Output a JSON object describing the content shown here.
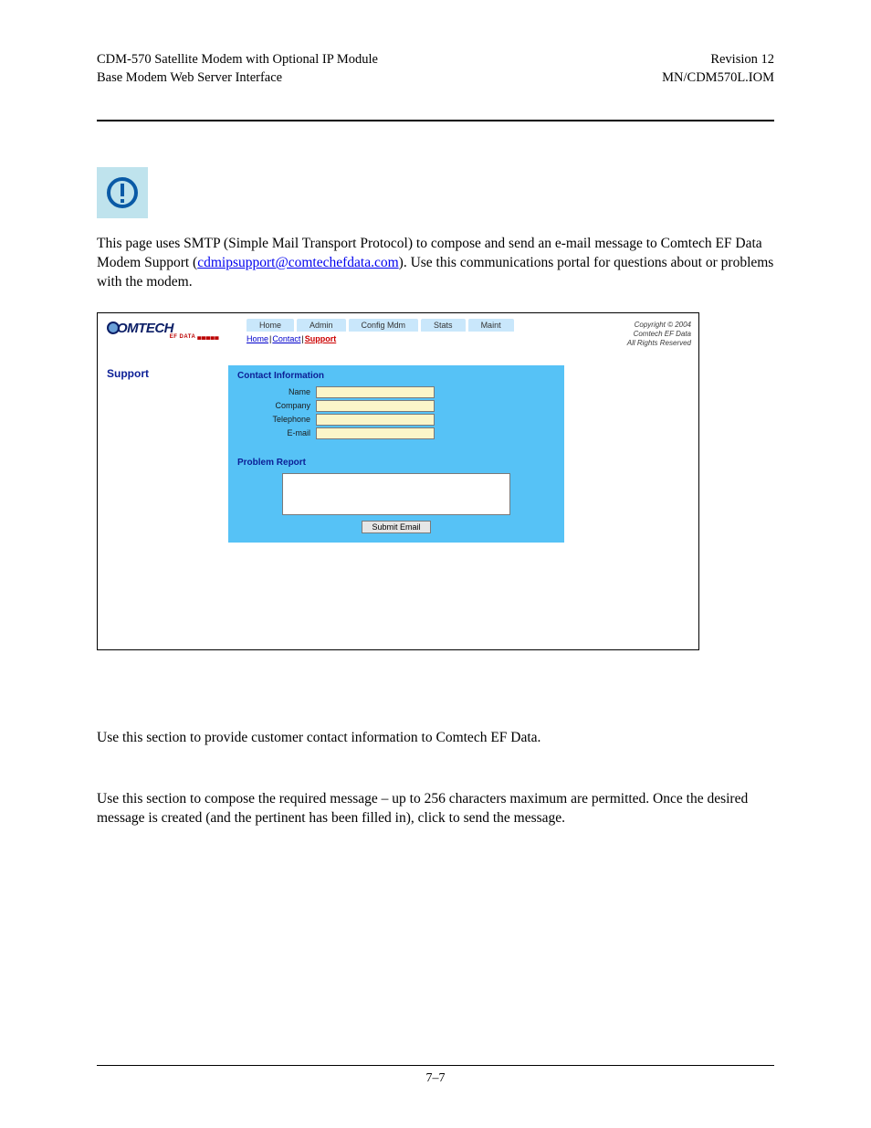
{
  "header": {
    "left_line1": "CDM-570 Satellite Modem with Optional IP Module",
    "left_line2": "Base Modem Web Server Interface",
    "right_line1": "Revision 12",
    "right_line2": "MN/CDM570L.IOM"
  },
  "intro": {
    "before": "This page uses SMTP (Simple Mail Transport Protocol) to compose and send an e-mail message to Comtech EF Data Modem Support (",
    "link": "cdmipsupport@comtechefdata.com",
    "after": "). Use this communications portal for questions about or problems with the modem."
  },
  "figure": {
    "logo_text": "OMTECH",
    "logo_sub": "EF DATA ▄▄▄▄▄",
    "tabs": [
      "Home",
      "Admin",
      "Config Mdm",
      "Stats",
      "Maint"
    ],
    "sublinks": {
      "home": "Home",
      "contact": "Contact",
      "support": "Support"
    },
    "copyright_l1": "Copyright © 2004",
    "copyright_l2": "Comtech EF Data",
    "copyright_l3": "All Rights Reserved",
    "support_title": "Support",
    "contact_panel": {
      "title": "Contact Information",
      "fields": {
        "name": "Name",
        "company": "Company",
        "telephone": "Telephone",
        "email": "E-mail"
      }
    },
    "problem_panel": {
      "title": "Problem Report",
      "submit": "Submit Email"
    }
  },
  "body": {
    "p1": "Use this section to provide customer contact information to Comtech EF Data.",
    "p2_a": "Use this section to compose the required message – up to 256 characters maximum are permitted. Once the desired message is created (and the pertinent ",
    "p2_b": " has been filled in), click ",
    "p2_c": " to send the message."
  },
  "footer": {
    "page": "7–7"
  }
}
